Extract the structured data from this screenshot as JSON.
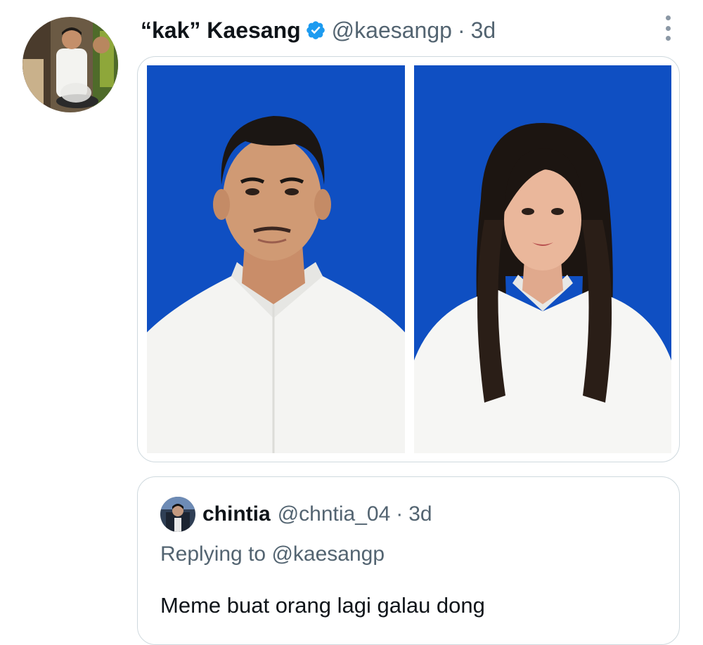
{
  "tweet": {
    "display_name": "“kak” Kaesang",
    "handle": "@kaesangp",
    "separator": "·",
    "time": "3d",
    "verified": true,
    "avatar_icon": "profile-photo-chef",
    "more_icon": "vertical-ellipsis-icon",
    "media": [
      {
        "kind": "photo",
        "subject": "man-portrait",
        "background": "#0f4fc2"
      },
      {
        "kind": "photo",
        "subject": "woman-portrait",
        "background": "#0f4fc2"
      }
    ]
  },
  "quote": {
    "display_name": "chintia",
    "handle": "@chntia_04",
    "separator": "·",
    "time": "3d",
    "replying_prefix": "Replying to",
    "replying_mention": "@kaesangp",
    "text": "Meme buat orang lagi galau dong",
    "avatar_icon": "profile-photo"
  },
  "colors": {
    "text_primary": "#0f1419",
    "text_secondary": "#536471",
    "verified_badge": "#1d9bf0",
    "border": "#cfd9de",
    "photo_background": "#0f4fc2"
  }
}
